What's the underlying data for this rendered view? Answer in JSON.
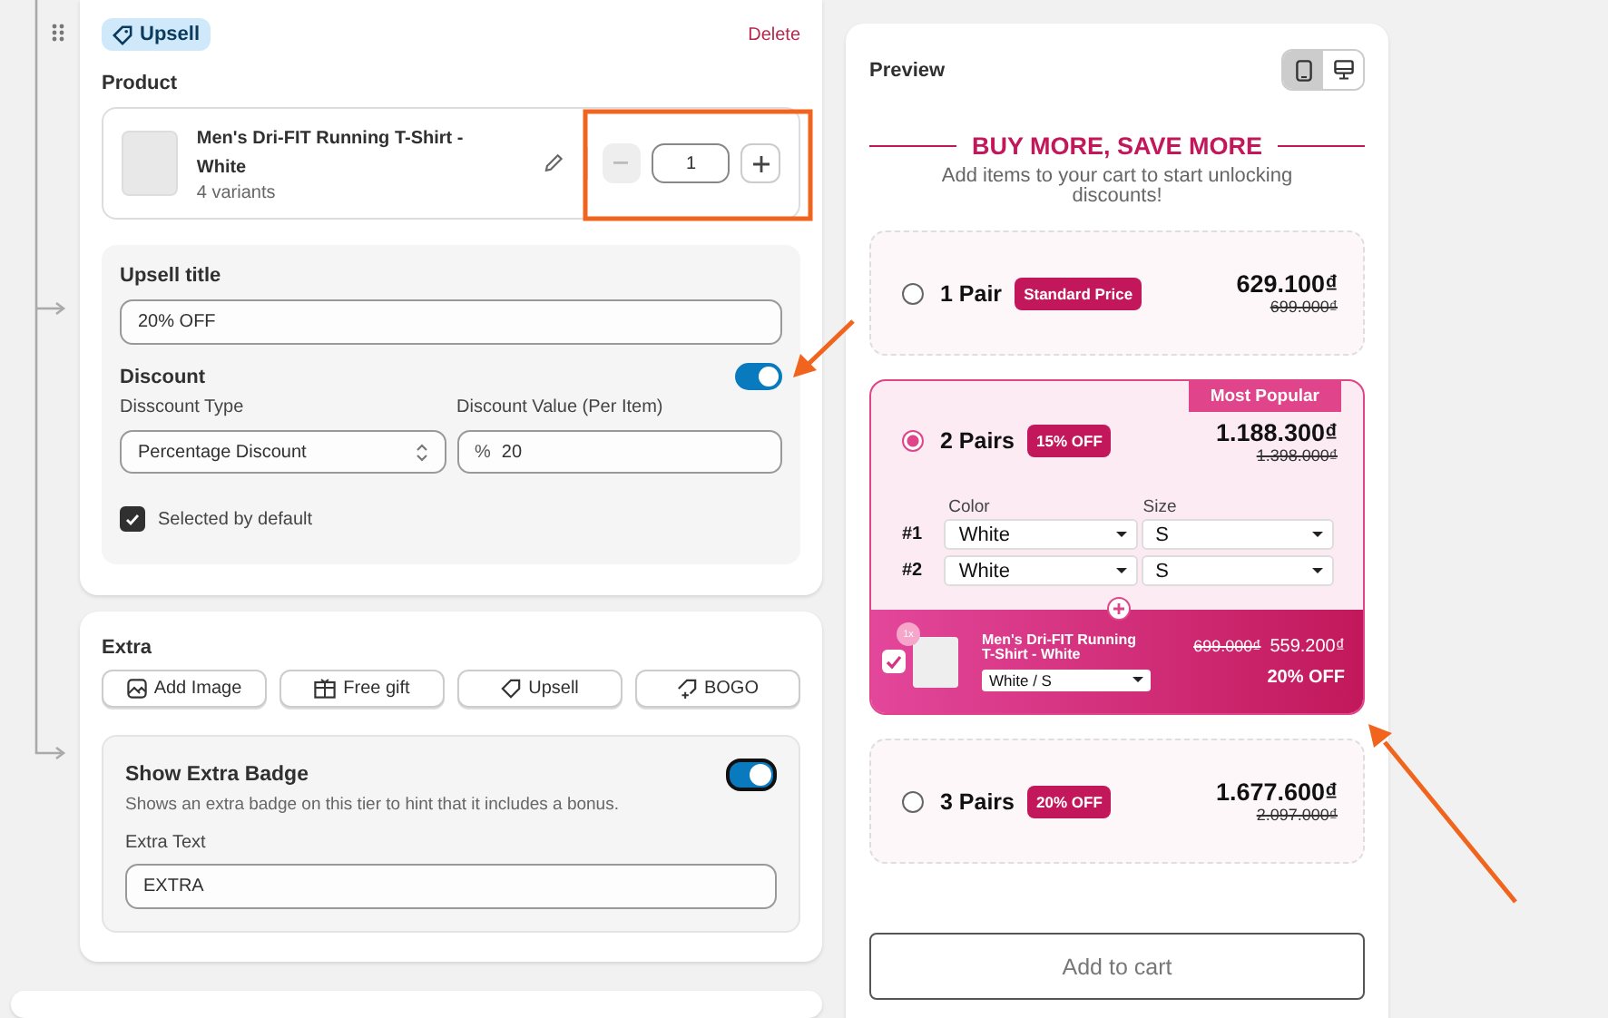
{
  "editor": {
    "tag": "Upsell",
    "delete": "Delete",
    "product_label": "Product",
    "product": {
      "name": "Men's Dri-FIT Running T-Shirt - White",
      "variants": "4 variants",
      "quantity": "1"
    },
    "upsell_title": {
      "label": "Upsell title",
      "value": "20% OFF"
    },
    "discount": {
      "label": "Discount",
      "on": true,
      "type_label": "Disscount Type",
      "type_value": "Percentage Discount",
      "value_label": "Discount Value (Per Item)",
      "value_prefix": "%",
      "value": "20"
    },
    "selected_by_default": {
      "label": "Selected by default",
      "checked": true
    }
  },
  "extra": {
    "title": "Extra",
    "buttons": [
      {
        "label": "Add Image",
        "kind": "image"
      },
      {
        "label": "Free gift",
        "kind": "gift"
      },
      {
        "label": "Upsell",
        "kind": "tag"
      },
      {
        "label": "BOGO",
        "kind": "bogo"
      }
    ],
    "badge": {
      "title": "Show Extra Badge",
      "on": true,
      "description": "Shows an extra badge on this tier to hint that it includes a bonus.",
      "field_label": "Extra Text",
      "value": "EXTRA"
    }
  },
  "preview": {
    "title": "Preview",
    "devices": [
      {
        "kind": "mobile",
        "selected": true
      },
      {
        "kind": "desktop",
        "selected": false
      }
    ],
    "heading": "BUY MORE, SAVE MORE",
    "subtitle": "Add items to your cart to start unlocking discounts!",
    "tiers": [
      {
        "title": "1 Pair",
        "badge": "Standard Price",
        "price": "629.100₫",
        "compare": "699.000₫",
        "selected": false
      },
      {
        "title": "2 Pairs",
        "badge": "15% OFF",
        "price": "1.188.300₫",
        "compare": "1.398.000₫",
        "selected": true,
        "ribbon": "Most Popular",
        "variant_headers": [
          "Color",
          "Size"
        ],
        "variants": [
          {
            "index": "#1",
            "color_option": "White",
            "size_option": "S"
          },
          {
            "index": "#2",
            "color_option": "White",
            "size_option": "S"
          }
        ],
        "upsell": {
          "checked": true,
          "quantity": "1x",
          "name": "Men's Dri-FIT Running T-Shirt - White",
          "option": "White / S",
          "compare": "699.000₫",
          "price": "559.200₫",
          "discount": "20% OFF"
        }
      },
      {
        "title": "3 Pairs",
        "badge": "20% OFF",
        "price": "1.677.600₫",
        "compare": "2.097.000₫",
        "selected": false
      }
    ],
    "button": "Add to cart"
  }
}
